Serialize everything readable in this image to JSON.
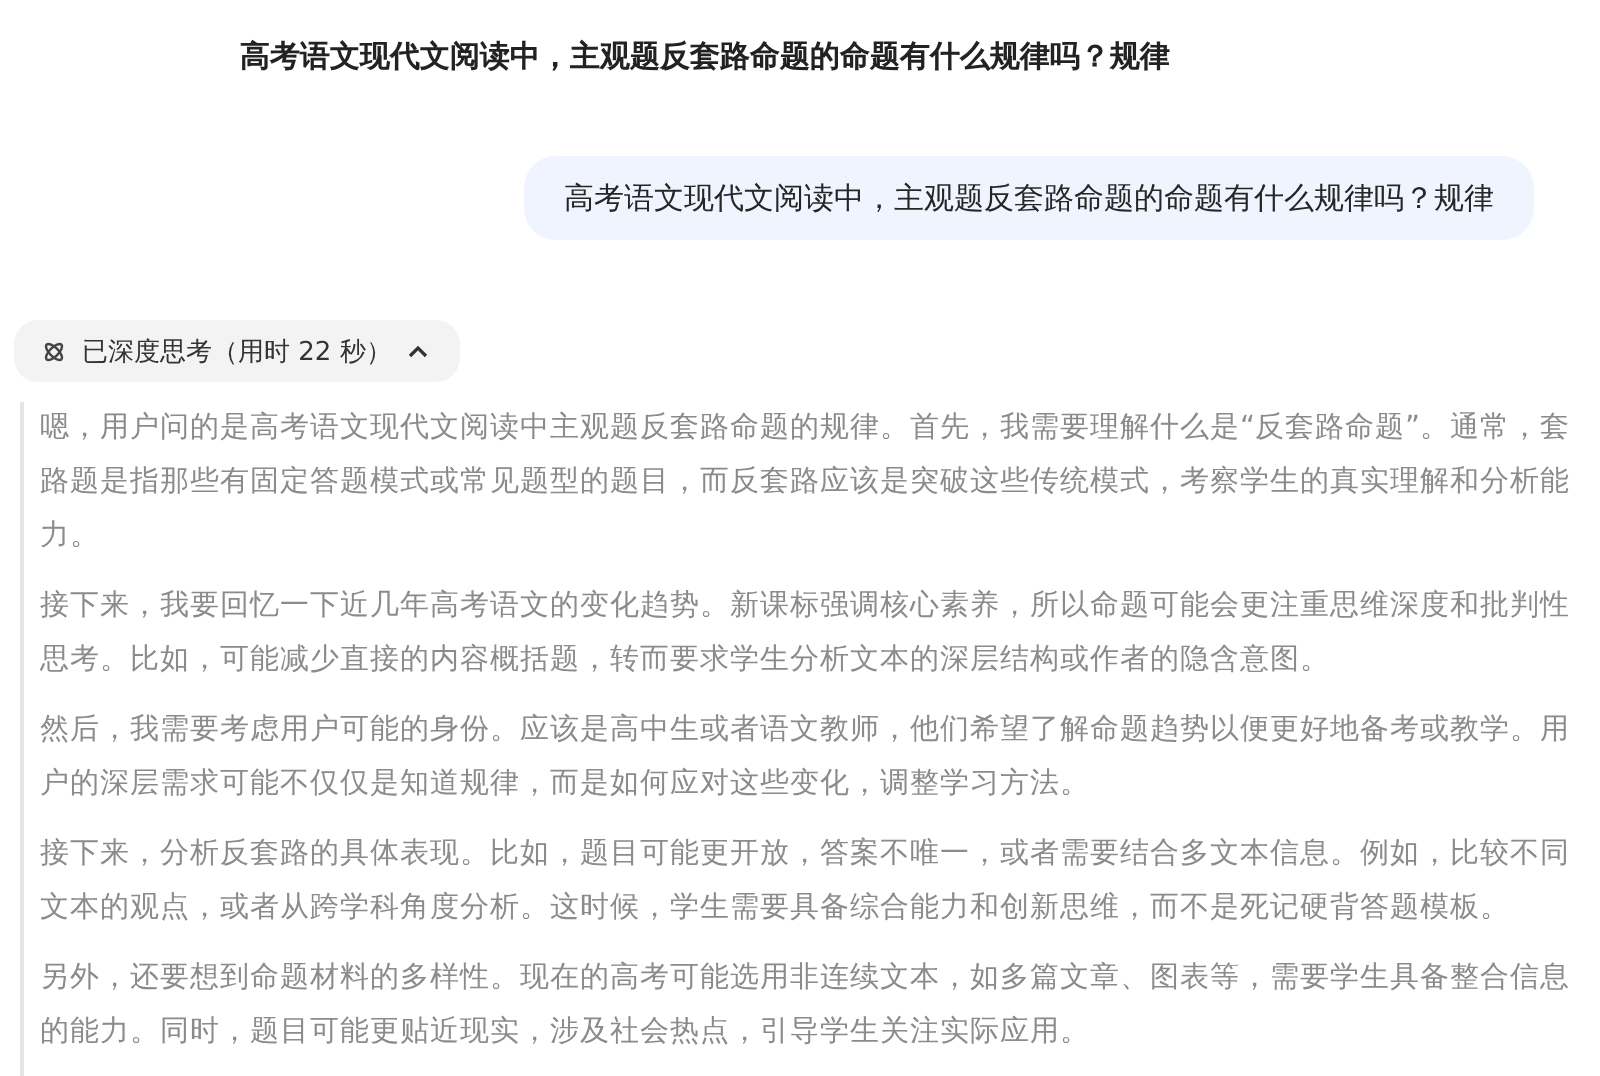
{
  "title": "高考语文现代文阅读中，主观题反套路命题的命题有什么规律吗？规律",
  "user_message": "高考语文现代文阅读中，主观题反套路命题的命题有什么规律吗？规律",
  "thinking": {
    "label": "已深度思考（用时 22 秒）",
    "expanded": true,
    "paragraphs": [
      "嗯，用户问的是高考语文现代文阅读中主观题反套路命题的规律。首先，我需要理解什么是“反套路命题”。通常，套路题是指那些有固定答题模式或常见题型的题目，而反套路应该是突破这些传统模式，考察学生的真实理解和分析能力。",
      "接下来，我要回忆一下近几年高考语文的变化趋势。新课标强调核心素养，所以命题可能会更注重思维深度和批判性思考。比如，可能减少直接的内容概括题，转而要求学生分析文本的深层结构或作者的隐含意图。",
      "然后，我需要考虑用户可能的身份。应该是高中生或者语文教师，他们希望了解命题趋势以便更好地备考或教学。用户的深层需求可能不仅仅是知道规律，而是如何应对这些变化，调整学习方法。",
      "接下来，分析反套路的具体表现。比如，题目可能更开放，答案不唯一，或者需要结合多文本信息。例如，比较不同文本的观点，或者从跨学科角度分析。这时候，学生需要具备综合能力和创新思维，而不是死记硬背答题模板。",
      "另外，还要想到命题材料的多样性。现在的高考可能选用非连续文本，如多篇文章、图表等，需要学生具备整合信息的能力。同时，题目可能更贴近现实，涉及社会热点，引导学生关注实际应用。"
    ]
  }
}
